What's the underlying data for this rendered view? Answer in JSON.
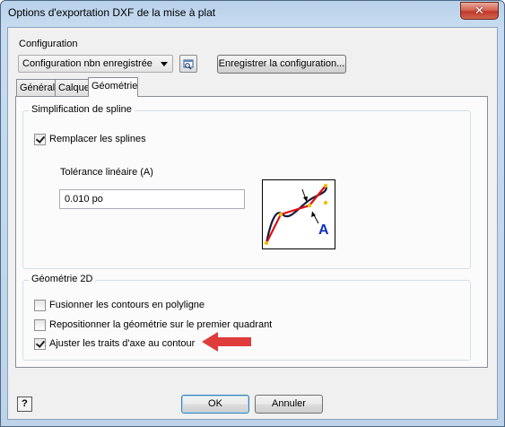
{
  "window": {
    "title": "Options d'exportation DXF de la mise à plat",
    "close_glyph": "✕"
  },
  "configuration": {
    "label": "Configuration",
    "selected": "Configuration nbn enregistrée",
    "save_button": "Enregistrer la configuration..."
  },
  "tabs": [
    {
      "label": "Général",
      "active": false
    },
    {
      "label": "Calque",
      "active": false
    },
    {
      "label": "Géométrie",
      "active": true
    }
  ],
  "spline": {
    "group_title": "Simplification de spline",
    "replace_label": "Remplacer les splines",
    "replace_checked": true,
    "tolerance_label": "Tolérance linéaire (A)",
    "tolerance_value": "0.010 po",
    "illustration_letter": "A"
  },
  "geometry2d": {
    "group_title": "Géométrie 2D",
    "options": [
      {
        "label": "Fusionner les contours en polyligne",
        "checked": false
      },
      {
        "label": "Repositionner la géométrie sur le premier quadrant",
        "checked": false
      },
      {
        "label": "Ajuster les traits d'axe au contour",
        "checked": true
      }
    ]
  },
  "footer": {
    "help_glyph": "?",
    "ok_label": "OK",
    "cancel_label": "Annuler"
  },
  "colors": {
    "annotation_arrow": "#e03c3c",
    "spline_curve": "#1a1a40",
    "polyline": "#e01010",
    "vertex": "#f0c000",
    "label_blue": "#1030c0"
  }
}
